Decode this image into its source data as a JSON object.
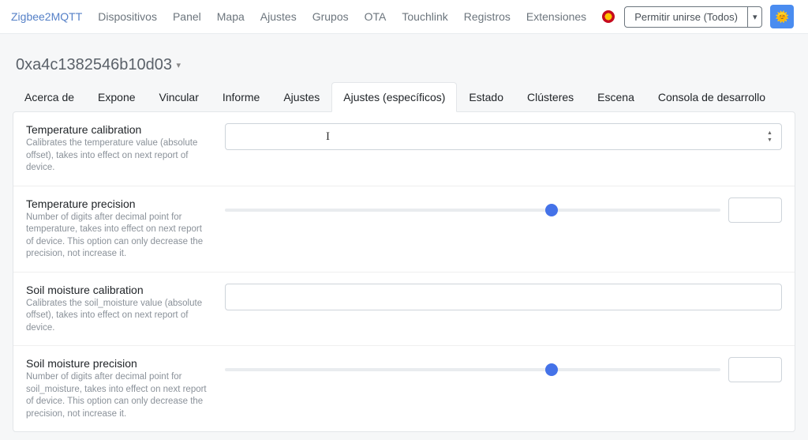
{
  "navbar": {
    "brand": "Zigbee2MQTT",
    "links": [
      "Dispositivos",
      "Panel",
      "Mapa",
      "Ajustes",
      "Grupos",
      "OTA",
      "Touchlink",
      "Registros",
      "Extensiones"
    ],
    "flag": "spain",
    "permit_label": "Permitir unirse (Todos)",
    "theme_icon": "🌞"
  },
  "device": {
    "title": "0xa4c1382546b10d03"
  },
  "tabs": [
    {
      "label": "Acerca de",
      "active": false
    },
    {
      "label": "Expone",
      "active": false
    },
    {
      "label": "Vincular",
      "active": false
    },
    {
      "label": "Informe",
      "active": false
    },
    {
      "label": "Ajustes",
      "active": false
    },
    {
      "label": "Ajustes (específicos)",
      "active": true
    },
    {
      "label": "Estado",
      "active": false
    },
    {
      "label": "Clústeres",
      "active": false
    },
    {
      "label": "Escena",
      "active": false
    },
    {
      "label": "Consola de desarrollo",
      "active": false
    }
  ],
  "settings": [
    {
      "title": "Temperature calibration",
      "desc": "Calibrates the temperature value (absolute offset), takes into effect on next report of device.",
      "type": "number",
      "value": "",
      "show_cursor": true
    },
    {
      "title": "Temperature precision",
      "desc": "Number of digits after decimal point for temperature, takes into effect on next report of device. This option can only decrease the precision, not increase it.",
      "type": "slider",
      "thumb_pct": 66
    },
    {
      "title": "Soil moisture calibration",
      "desc": "Calibrates the soil_moisture value (absolute offset), takes into effect on next report of device.",
      "type": "number",
      "value": "",
      "show_cursor": false
    },
    {
      "title": "Soil moisture precision",
      "desc": "Number of digits after decimal point for soil_moisture, takes into effect on next report of device. This option can only decrease the precision, not increase it.",
      "type": "slider",
      "thumb_pct": 66
    }
  ]
}
